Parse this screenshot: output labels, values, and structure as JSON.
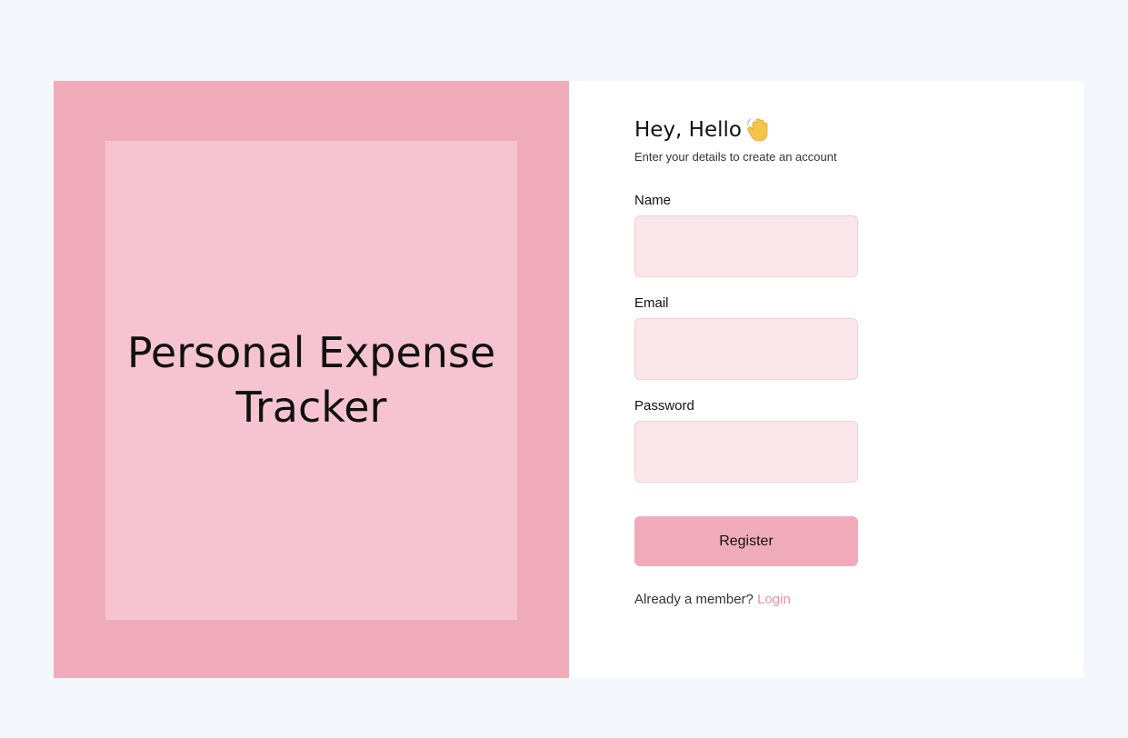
{
  "brand": {
    "title": "Personal Expense Tracker"
  },
  "header": {
    "greeting": "Hey, Hello",
    "subtitle": "Enter your details to create an account"
  },
  "form": {
    "name_label": "Name",
    "name_value": "",
    "email_label": "Email",
    "email_value": "",
    "password_label": "Password",
    "password_value": "",
    "register_label": "Register"
  },
  "footer": {
    "prompt": "Already a member?",
    "login_label": "Login"
  },
  "icons": {
    "greeting_icon": "waving-hand-icon"
  },
  "colors": {
    "page_bg": "#f4f7fc",
    "panel_outer": "#f0abbb",
    "panel_inner": "#f6c4d0",
    "input_bg": "#fbe6eb",
    "button_bg": "#f0abbb",
    "link": "#ec8fa4"
  }
}
